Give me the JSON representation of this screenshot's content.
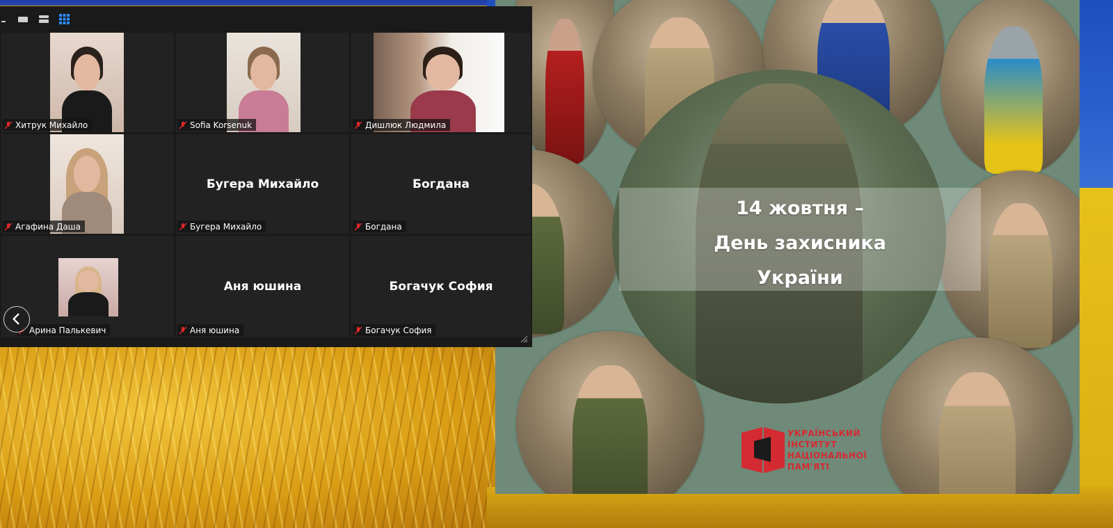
{
  "gallery": {
    "toolbar": {
      "icons": [
        "minimize-icon",
        "speaker-view-icon",
        "strip-view-icon",
        "gallery-view-icon"
      ],
      "active_icon": "gallery-view-icon"
    },
    "tiles": [
      {
        "name": "Хитрук Михайло",
        "video": true,
        "muted": true
      },
      {
        "name": "Sofia Korsenuk",
        "video": true,
        "muted": true
      },
      {
        "name": "Дишлюк Людмила",
        "video": true,
        "muted": true
      },
      {
        "name": "Агафина Даша",
        "video": true,
        "muted": true
      },
      {
        "name": "Бугера Михайло",
        "video": false,
        "muted": true,
        "display_name": "Бугера Михайло"
      },
      {
        "name": "Богдана",
        "video": false,
        "muted": true,
        "display_name": "Богдана"
      },
      {
        "name": "Арина Палькевич",
        "video": true,
        "muted": true
      },
      {
        "name": "Аня юшина",
        "video": false,
        "muted": true,
        "display_name": "Аня юшина"
      },
      {
        "name": "Богачук София",
        "video": false,
        "muted": true,
        "display_name": "Богачук София"
      }
    ],
    "nav": {
      "prev_icon": "chevron-left-icon"
    },
    "colors": {
      "background": "#1a1a1a",
      "tile": "#222222",
      "muted_icon": "#e02828",
      "active_view": "#2d8cff"
    }
  },
  "slide": {
    "title_lines": [
      "14 жовтня –",
      "День захисника",
      "України"
    ],
    "logo_text": [
      "УКРАЇНСЬКИЙ",
      "ІНСТИТУТ",
      "НАЦІОНАЛЬНОЇ",
      "ПАМ'ЯТІ"
    ],
    "colors": {
      "background": "#6f8a79",
      "logo_red": "#d42a32"
    }
  },
  "desktop": {
    "colors": {
      "flag_blue": "#2b5fce",
      "flag_yellow": "#e0b818"
    }
  }
}
